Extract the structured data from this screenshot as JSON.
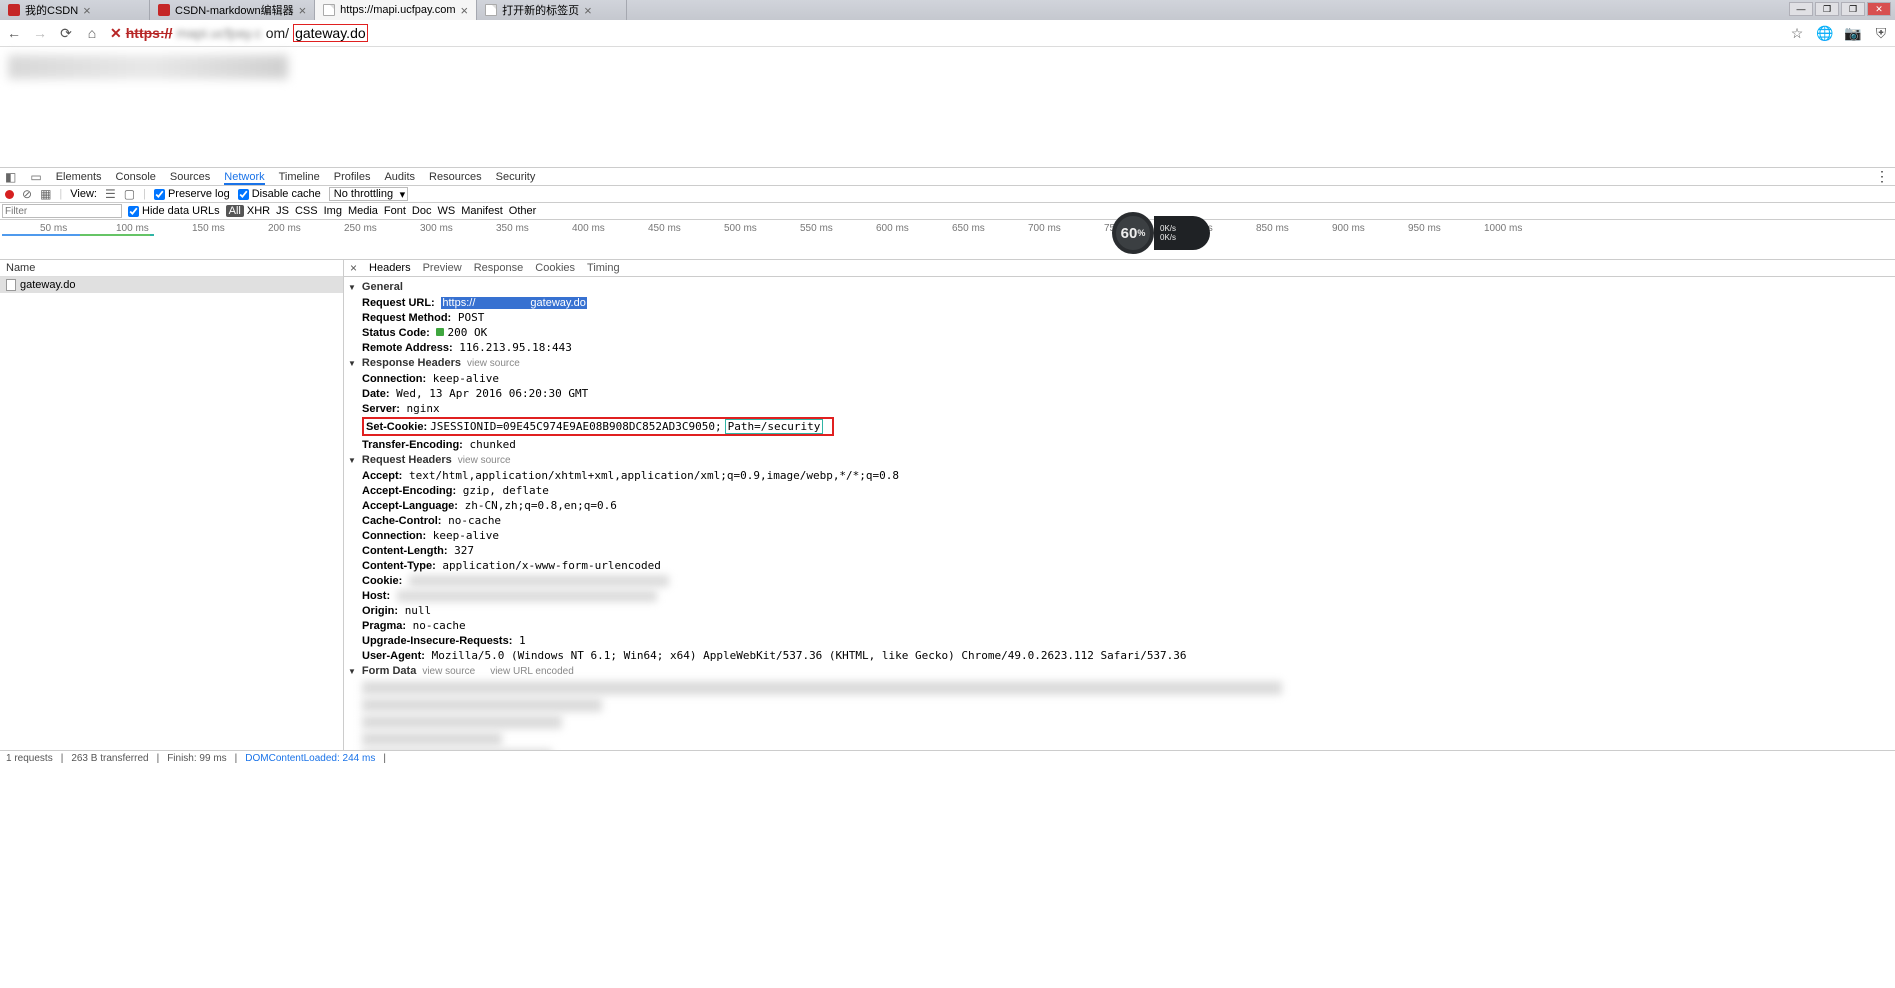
{
  "browser": {
    "tabs": [
      {
        "title": "我的CSDN",
        "favicon": "csdn"
      },
      {
        "title": "CSDN-markdown编辑器",
        "favicon": "csdn"
      },
      {
        "title": "https://mapi.ucfpay.com",
        "favicon": "page",
        "active": true
      },
      {
        "title": "打开新的标签页",
        "favicon": "page"
      }
    ],
    "url": {
      "scheme": "https://",
      "domain_blur": "mapi.ucfpay.c",
      "domain_suffix": "om/",
      "path": "gateway.do"
    }
  },
  "devtools": {
    "tabs": [
      "Elements",
      "Console",
      "Sources",
      "Network",
      "Timeline",
      "Profiles",
      "Audits",
      "Resources",
      "Security"
    ],
    "active_tab": "Network",
    "toolbar": {
      "view": "View:",
      "preserve": "Preserve log",
      "disable_cache": "Disable cache",
      "throttling": "No throttling"
    },
    "filter": {
      "placeholder": "Filter",
      "hide_urls": "Hide data URLs",
      "types": [
        "All",
        "XHR",
        "JS",
        "CSS",
        "Img",
        "Media",
        "Font",
        "Doc",
        "WS",
        "Manifest",
        "Other"
      ],
      "active_type": "All"
    },
    "timeline_ticks": [
      "50 ms",
      "100 ms",
      "150 ms",
      "200 ms",
      "250 ms",
      "300 ms",
      "350 ms",
      "400 ms",
      "450 ms",
      "500 ms",
      "550 ms",
      "600 ms",
      "650 ms",
      "700 ms",
      "750 ms",
      "800 ms",
      "850 ms",
      "900 ms",
      "950 ms",
      "1000 ms"
    ]
  },
  "speed": {
    "value": "60",
    "unit": "%",
    "up": "0K/s",
    "down": "0K/s"
  },
  "network": {
    "name_header": "Name",
    "request_name": "gateway.do",
    "detail_tabs": [
      "Headers",
      "Preview",
      "Response",
      "Cookies",
      "Timing"
    ],
    "active_detail": "Headers",
    "sections": {
      "general": {
        "title": "General",
        "request_url_label": "Request URL:",
        "request_url_scheme": "https://",
        "request_url_path": "gateway.do",
        "method_label": "Request Method:",
        "method": "POST",
        "status_label": "Status Code:",
        "status": "200 OK",
        "remote_label": "Remote Address:",
        "remote": "116.213.95.18:443"
      },
      "response_headers": {
        "title": "Response Headers",
        "view_source": "view source",
        "items": [
          {
            "k": "Connection:",
            "v": "keep-alive"
          },
          {
            "k": "Date:",
            "v": "Wed, 13 Apr 2016 06:20:30 GMT"
          },
          {
            "k": "Server:",
            "v": "nginx"
          }
        ],
        "set_cookie_label": "Set-Cookie:",
        "set_cookie_val": "JSESSIONID=09E45C974E9AE08B908DC852AD3C9050;",
        "set_cookie_path": "Path=/security",
        "transfer_label": "Transfer-Encoding:",
        "transfer_val": "chunked"
      },
      "request_headers": {
        "title": "Request Headers",
        "view_source": "view source",
        "items": [
          {
            "k": "Accept:",
            "v": "text/html,application/xhtml+xml,application/xml;q=0.9,image/webp,*/*;q=0.8"
          },
          {
            "k": "Accept-Encoding:",
            "v": "gzip, deflate"
          },
          {
            "k": "Accept-Language:",
            "v": "zh-CN,zh;q=0.8,en;q=0.6"
          },
          {
            "k": "Cache-Control:",
            "v": "no-cache"
          },
          {
            "k": "Connection:",
            "v": "keep-alive"
          },
          {
            "k": "Content-Length:",
            "v": "327"
          },
          {
            "k": "Content-Type:",
            "v": "application/x-www-form-urlencoded"
          },
          {
            "k": "Cookie:",
            "blur": true
          },
          {
            "k": "Host:",
            "blur": true
          },
          {
            "k": "Origin:",
            "v": "null"
          },
          {
            "k": "Pragma:",
            "v": "no-cache"
          },
          {
            "k": "Upgrade-Insecure-Requests:",
            "v": "1"
          },
          {
            "k": "User-Agent:",
            "v": "Mozilla/5.0 (Windows NT 6.1; Win64; x64) AppleWebKit/537.36 (KHTML, like Gecko) Chrome/49.0.2623.112 Safari/537.36"
          }
        ]
      },
      "form_data": {
        "title": "Form Data",
        "view_source": "view source",
        "view_url": "view URL encoded"
      }
    }
  },
  "status_bar": {
    "requests": "1 requests",
    "transferred": "263 B transferred",
    "finish": "Finish: 99 ms",
    "dom": "DOMContentLoaded: 244 ms"
  }
}
